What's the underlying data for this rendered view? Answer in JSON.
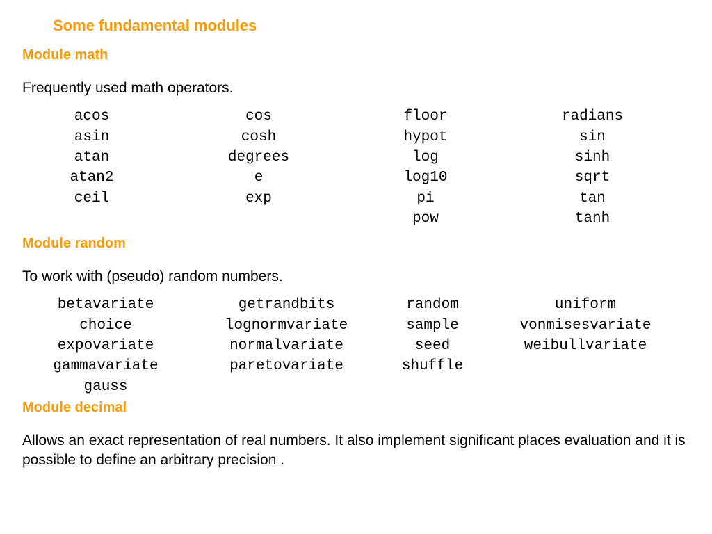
{
  "title": "Some fundamental modules",
  "sections": [
    {
      "heading": "Module math",
      "desc": "Frequently used math operators.",
      "columns": [
        [
          "acos",
          "asin",
          "atan",
          "atan2",
          "ceil",
          ""
        ],
        [
          "cos",
          "cosh",
          "degrees",
          "e",
          "exp",
          ""
        ],
        [
          "floor",
          "hypot",
          "log",
          "log10",
          "pi",
          "pow"
        ],
        [
          "radians",
          "sin",
          "sinh",
          "sqrt",
          "tan",
          "tanh"
        ]
      ]
    },
    {
      "heading": "Module random",
      "desc": "To work with (pseudo) random numbers.",
      "columns": [
        [
          "betavariate",
          "choice",
          "expovariate",
          "gammavariate",
          "gauss"
        ],
        [
          "getrandbits",
          "lognormvariate",
          "normalvariate",
          "paretovariate",
          ""
        ],
        [
          "random",
          "sample",
          "seed",
          "shuffle",
          ""
        ],
        [
          "uniform",
          "vonmisesvariate",
          "weibullvariate",
          "",
          ""
        ]
      ]
    },
    {
      "heading": "Module decimal",
      "desc": "Allows an exact representation of real numbers. It also implement significant places evaluation and it is possible to define an arbitrary precision ."
    }
  ]
}
